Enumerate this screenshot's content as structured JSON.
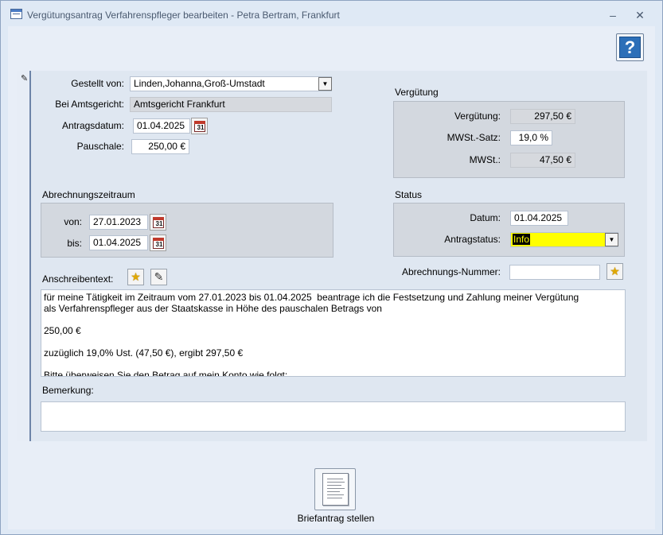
{
  "window": {
    "title": "Vergütungsantrag Verfahrenspfleger bearbeiten - Petra Bertram, Frankfurt",
    "minimize_glyph": "–",
    "close_glyph": "✕"
  },
  "help_button": {
    "glyph": "?",
    "icon": "help-icon"
  },
  "form": {
    "gestellt_von": {
      "label": "Gestellt von:",
      "value": "Linden,Johanna,Groß-Umstadt"
    },
    "amtsgericht": {
      "label": "Bei Amtsgericht:",
      "value": "Amtsgericht Frankfurt"
    },
    "antragsdatum": {
      "label": "Antragsdatum:",
      "value": "01.04.2025"
    },
    "pauschale": {
      "label": "Pauschale:",
      "value": "250,00 €"
    }
  },
  "verguetung_group": {
    "title": "Vergütung",
    "verguetung": {
      "label": "Vergütung:",
      "value": "297,50 €"
    },
    "mwst_satz": {
      "label": "MWSt.-Satz:",
      "value": "19,0 %"
    },
    "mwst": {
      "label": "MWSt.:",
      "value": "47,50 €"
    }
  },
  "abrechnungszeitraum": {
    "title": "Abrechnungszeitraum",
    "von": {
      "label": "von:",
      "value": "27.01.2023"
    },
    "bis": {
      "label": "bis:",
      "value": "01.04.2025"
    }
  },
  "status_group": {
    "title": "Status",
    "datum": {
      "label": "Datum:",
      "value": "01.04.2025"
    },
    "antragstatus": {
      "label": "Antragstatus:",
      "value": "Info",
      "highlight_color": "#ffff00"
    }
  },
  "abrechnungs_nummer": {
    "label": "Abrechnungs-Nummer:",
    "value": ""
  },
  "anschreibentext": {
    "label": "Anschreibentext:",
    "lines": [
      "für meine Tätigkeit im Zeitraum vom 27.01.2023 bis 01.04.2025  beantrage ich die Festsetzung und Zahlung meiner Vergütung",
      "als Verfahrenspfleger aus der Staatskasse in Höhe des pauschalen Betrags von",
      "250,00 €",
      "zuzüglich 19,0% Ust. (47,50 €), ergibt 297,50 €",
      "Bitte überweisen Sie den Betrag auf mein Konto wie folgt:"
    ]
  },
  "bemerkung": {
    "label": "Bemerkung:",
    "value": ""
  },
  "calendar_icon_text": "31",
  "briefantrag_button": {
    "label": "Briefantrag stellen",
    "icon": "document-icon"
  },
  "colors": {
    "window_bg": "#dfe9f5",
    "group_bg": "#d3d8df",
    "help_blue": "#2c6fb8"
  }
}
